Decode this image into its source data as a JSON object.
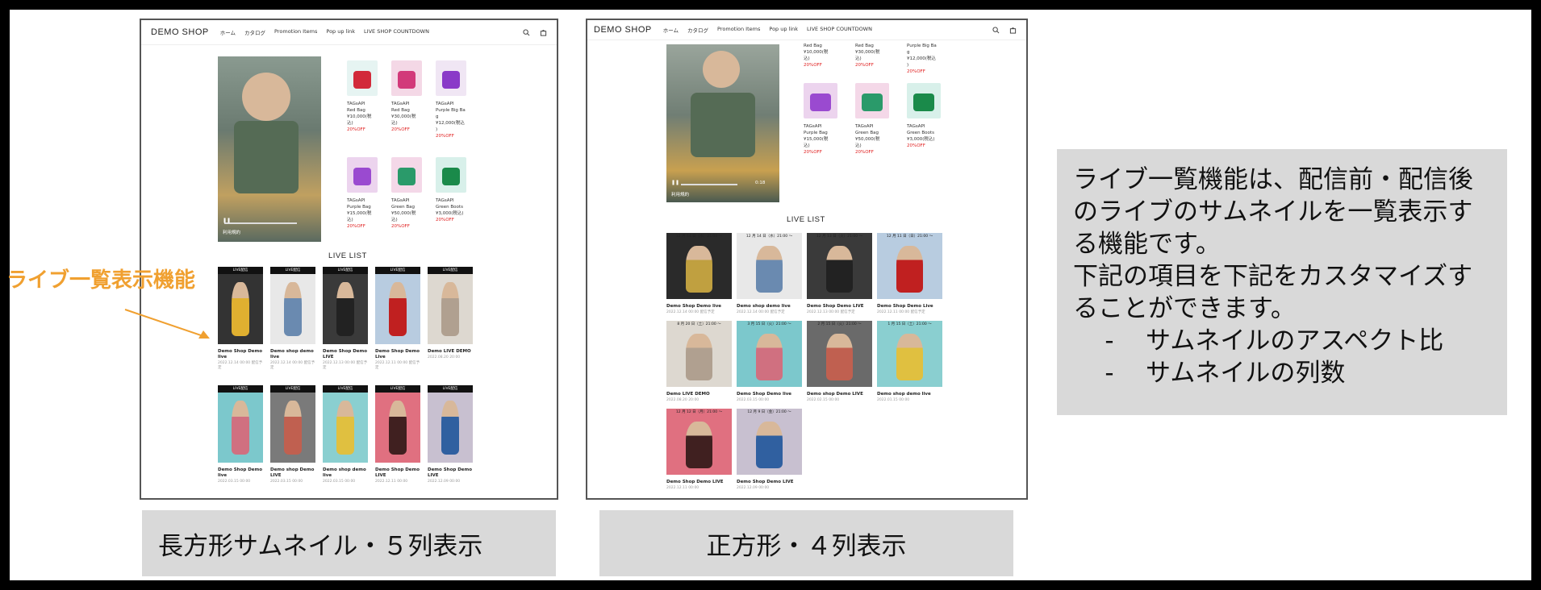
{
  "shop": {
    "brand": "DEMO SHOP",
    "nav": [
      "ホーム",
      "カタログ",
      "Promotion Items",
      "Pop up link",
      "LIVE SHOP COUNTDOWN"
    ]
  },
  "live_list_title": "LIVE LIST",
  "left_products": [
    {
      "brand": "TAGsAPI",
      "name": "Red Bag",
      "price": "¥10,000(税\n込)",
      "discount": "20%OFF",
      "color": "#d22a3a",
      "bg": "#e6f4f2"
    },
    {
      "brand": "TAGsAPI",
      "name": "Red Bag",
      "price": "¥30,000(税\n込)",
      "discount": "20%OFF",
      "color": "#d23a7a",
      "bg": "#f4d8e6"
    },
    {
      "brand": "TAGsAPI",
      "name": "Purple Big Ba\ng",
      "price": "¥12,000(税込\n)",
      "discount": "20%OFF",
      "color": "#8a3ac8",
      "bg": "#f0e6f4"
    },
    {
      "brand": "TAGsAPI",
      "name": "Purple Bag",
      "price": "¥15,000(税\n込)",
      "discount": "20%OFF",
      "color": "#9a4ad0",
      "bg": "#ecd4ee"
    },
    {
      "brand": "TAGsAPI",
      "name": "Green Bag",
      "price": "¥50,000(税\n込)",
      "discount": "20%OFF",
      "color": "#2a9a6a",
      "bg": "#f4d8e8"
    },
    {
      "brand": "TAGsAPI",
      "name": "Green Boots",
      "price": "¥3,000(税込)",
      "discount": "20%OFF",
      "color": "#1a8a4a",
      "bg": "#d8f0ea"
    }
  ],
  "right_products": [
    {
      "brand": "TAGsAPI",
      "name": "Red Bag",
      "price": "¥10,000(税\n込)",
      "discount": "20%OFF"
    },
    {
      "brand": "TAGsAPI",
      "name": "Red Bag",
      "price": "¥30,000(税\n込)",
      "discount": "20%OFF"
    },
    {
      "brand": "TAGsAPI",
      "name": "Purple Big Ba\ng",
      "price": "¥12,000(税込\n)",
      "discount": "20%OFF"
    },
    {
      "brand": "TAGsAPI",
      "name": "Purple Bag",
      "price": "¥15,000(税\n込)",
      "discount": "20%OFF",
      "color": "#9a4ad0",
      "bg": "#ecd4ee"
    },
    {
      "brand": "TAGsAPI",
      "name": "Green Bag",
      "price": "¥50,000(税\n込)",
      "discount": "20%OFF",
      "color": "#2a9a6a",
      "bg": "#f4d8e8"
    },
    {
      "brand": "TAGsAPI",
      "name": "Green Boots",
      "price": "¥3,000(税込)",
      "discount": "20%OFF",
      "color": "#1a8a4a",
      "bg": "#d8f0ea"
    }
  ],
  "video": {
    "left_label": "利用規約",
    "right_label": "利用規約",
    "right_time": "0:18"
  },
  "left_live": [
    {
      "badge": "LIVE配信",
      "title": "Demo Shop Demo\nlive",
      "date": "2022.12.14 00:00 配信予\n定",
      "bg": "#333",
      "accent": "#e0b030"
    },
    {
      "badge": "LIVE配信",
      "title": "Demo shop demo\nlive",
      "date": "2022.12.14 00:00 配信予\n定",
      "bg": "#e8e8e8",
      "accent": "#6a8ab0"
    },
    {
      "badge": "LIVE配信",
      "title": "Demo Shop Demo\nLIVE",
      "date": "2022.12.13 00:00 配信予\n定",
      "bg": "#3a3a3a",
      "accent": "#222"
    },
    {
      "badge": "LIVE配信",
      "title": "Demo Shop Demo\nLive",
      "date": "2022.12.11 00:00 配信予\n定",
      "bg": "#b8cce0",
      "accent": "#c02020"
    },
    {
      "badge": "LIVE配信",
      "title": "Demo LIVE DEMO",
      "date": "2022.08.20 20:00",
      "bg": "#ddd8d0",
      "accent": "#b0a090"
    },
    {
      "badge": "LIVE配信",
      "title": "Demo Shop Demo\nlive",
      "date": "2022.03.15 00:00",
      "bg": "#7cc8cc",
      "accent": "#d07080"
    },
    {
      "badge": "LIVE配信",
      "title": "Demo shop Demo\nLIVE",
      "date": "2022.03.15 00:00",
      "bg": "#7a7a7a",
      "accent": "#c06050"
    },
    {
      "badge": "LIVE配信",
      "title": "Demo shop demo\nlive",
      "date": "2022.03.15 00:00",
      "bg": "#8acfd0",
      "accent": "#e0c040"
    },
    {
      "badge": "LIVE配信",
      "title": "Demo Shop Demo\nLIVE",
      "date": "2022.12.11 00:00",
      "bg": "#e07080",
      "accent": "#402020"
    },
    {
      "badge": "LIVE配信",
      "title": "Demo Shop Demo\nLIVE",
      "date": "2022.12.09 00:00",
      "bg": "#c8c0d0",
      "accent": "#3060a0"
    }
  ],
  "right_live": [
    {
      "badge": "12 月 14 日（水）21:00 〜",
      "title": "Demo Shop Demo live",
      "date": "2022.12.14 00:00 配信予定",
      "bg": "#2a2a2a",
      "accent": "#c0a040"
    },
    {
      "badge": "12 月 14 日（水）21:00 〜",
      "title": "Demo shop demo live",
      "date": "2022.12.14 00:00 配信予定",
      "bg": "#e8e8e8",
      "accent": "#6a8ab0"
    },
    {
      "badge": "12 月 13 日（火）21:00 〜",
      "title": "Demo Shop Demo LIVE",
      "date": "2022.12.13 00:00 配信予定",
      "bg": "#3a3a3a",
      "accent": "#222"
    },
    {
      "badge": "12 月 11 日（日）21:00 〜",
      "title": "Demo Shop Demo Live",
      "date": "2022.12.11 00:00 配信予定",
      "bg": "#b8cce0",
      "accent": "#c02020"
    },
    {
      "badge": "8 月 20 日（土）21:00 〜",
      "title": "Demo LIVE DEMO",
      "date": "2022.08.20 20:00",
      "bg": "#ddd8d0",
      "accent": "#b0a090"
    },
    {
      "badge": "3 月 15 日（火）21:00 〜",
      "title": "Demo Shop Demo live",
      "date": "2022.03.15 00:00",
      "bg": "#7cc8cc",
      "accent": "#d07080"
    },
    {
      "badge": "2 月 15 日（火）21:00 〜",
      "title": "Demo shop Demo LIVE",
      "date": "2022.02.15 00:00",
      "bg": "#6a6a6a",
      "accent": "#c06050"
    },
    {
      "badge": "1 月 15 日（土）21:00 〜",
      "title": "Demo shop demo live",
      "date": "2022.01.15 00:00",
      "bg": "#8acfd0",
      "accent": "#e0c040"
    },
    {
      "badge": "12 月 12 日（月）21:00 〜",
      "title": "Demo Shop Demo LIVE",
      "date": "2022.12.11 00:00",
      "bg": "#e07080",
      "accent": "#402020"
    },
    {
      "badge": "12 月 9 日（金）21:00 〜",
      "title": "Demo Shop Demo LIVE",
      "date": "2022.12.09 00:00",
      "bg": "#c8c0d0",
      "accent": "#3060a0"
    }
  ],
  "captions": {
    "left": "長方形サムネイル・５列表示",
    "right": "正方形・４列表示"
  },
  "callout": "ライブ一覧表示機能",
  "note": {
    "body": "ライブ一覧機能は、配信前・配信後のライブのサムネイルを一覧表示する機能です。\n下記の項目を下記をカスタマイズすることができます。",
    "items": [
      "サムネイルのアスペクト比",
      "サムネイルの列数"
    ]
  },
  "colors": {
    "accent_orange": "#f0a030",
    "discount_red": "#e02020",
    "caption_bg": "#d9d9d9"
  }
}
